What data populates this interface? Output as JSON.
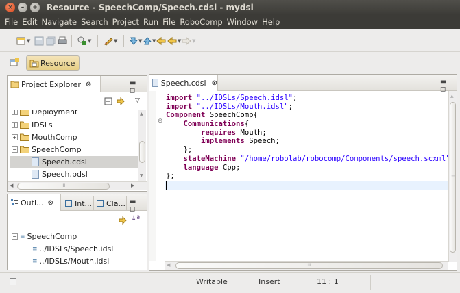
{
  "window": {
    "title": "Resource - SpeechComp/Speech.cdsl - mydsl",
    "controls": [
      "close-icon",
      "minimize-icon",
      "maximize-icon"
    ]
  },
  "menu": [
    "File",
    "Edit",
    "Navigate",
    "Search",
    "Project",
    "Run",
    "File",
    "RoboComp",
    "Window",
    "Help"
  ],
  "perspective": {
    "label": "Resource"
  },
  "project_explorer": {
    "title": "Project Explorer",
    "close": "⊗",
    "items": [
      {
        "label": "Deployment",
        "expander": "+",
        "icon": "folder-icon"
      },
      {
        "label": "IDSLs",
        "expander": "+",
        "icon": "folder-icon"
      },
      {
        "label": "MouthComp",
        "expander": "+",
        "icon": "folder-icon"
      },
      {
        "label": "SpeechComp",
        "expander": "−",
        "icon": "folder-icon"
      },
      {
        "label": "Speech.cdsl",
        "icon": "file-icon",
        "selected": true
      },
      {
        "label": "Speech.pdsl",
        "icon": "file-icon"
      }
    ],
    "hscroll_thumb_label": "III"
  },
  "outline": {
    "tabs": [
      "Outl...",
      "Int...",
      "Cla..."
    ],
    "close": "⊗",
    "root": {
      "label": "SpeechComp",
      "expander": "−"
    },
    "children": [
      "../IDSLs/Speech.idsl",
      "../IDSLs/Mouth.idsl"
    ]
  },
  "editor": {
    "tab_label": "Speech.cdsl",
    "close": "⊗",
    "lines": [
      [
        {
          "t": "import ",
          "c": "kw"
        },
        {
          "t": "\"../IDSLs/Speech.idsl\"",
          "c": "str"
        },
        {
          "t": ";"
        }
      ],
      [
        {
          "t": "import ",
          "c": "kw"
        },
        {
          "t": "\"../IDSLs/Mouth.idsl\"",
          "c": "str"
        },
        {
          "t": ";"
        }
      ],
      [
        {
          "t": "Component ",
          "c": "kw"
        },
        {
          "t": "SpeechComp{"
        }
      ],
      [
        {
          "t": "    "
        },
        {
          "t": "Communications",
          "c": "kw"
        },
        {
          "t": "{"
        }
      ],
      [
        {
          "t": "        "
        },
        {
          "t": "requires ",
          "c": "kw"
        },
        {
          "t": "Mouth;"
        }
      ],
      [
        {
          "t": "        "
        },
        {
          "t": "implements ",
          "c": "kw"
        },
        {
          "t": "Speech;"
        }
      ],
      [
        {
          "t": "    };"
        }
      ],
      [
        {
          "t": "    "
        },
        {
          "t": "stateMachine ",
          "c": "kw"
        },
        {
          "t": "\"/home/robolab/robocomp/Components/speech.scxml\"",
          "c": "str"
        },
        {
          "t": ";"
        }
      ],
      [
        {
          "t": "    "
        },
        {
          "t": "language ",
          "c": "kw"
        },
        {
          "t": "Cpp;"
        }
      ],
      [
        {
          "t": "};"
        }
      ],
      [
        {
          "t": ""
        }
      ]
    ],
    "fold_marker": "⊖",
    "hscroll_thumb_label": "III"
  },
  "status": {
    "writable": "Writable",
    "mode": "Insert",
    "position": "11 : 1"
  }
}
